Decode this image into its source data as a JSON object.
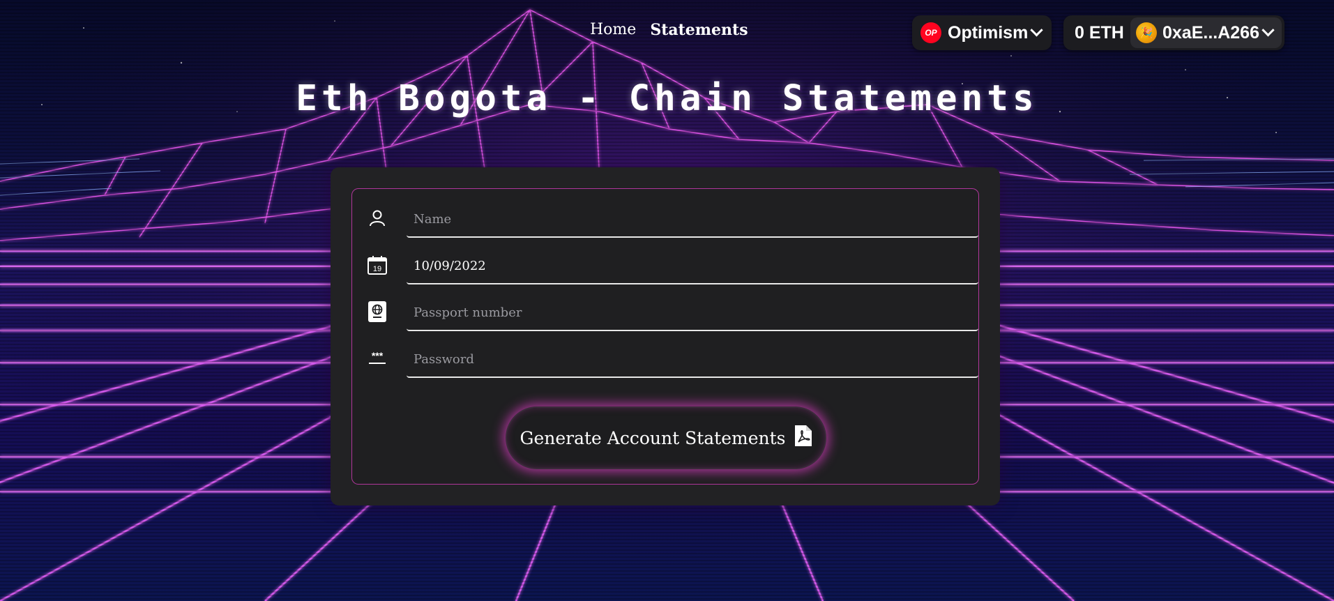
{
  "nav": {
    "home": "Home",
    "statements": "Statements"
  },
  "wallet": {
    "chain_logo": "OP",
    "chain_name": "Optimism",
    "balance": "0 ETH",
    "avatar_emoji": "🎉",
    "address": "0xaE...A266"
  },
  "title": "Eth Bogota - Chain Statements",
  "form": {
    "name_placeholder": "Name",
    "date_value": "10/09/2022",
    "calendar_day": "19",
    "passport_placeholder": "Passport number",
    "password_placeholder": "Password",
    "password_icon_text": "***",
    "submit_label": "Generate Account Statements"
  },
  "icons": {
    "name": "user-icon",
    "date": "calendar-icon",
    "passport": "passport-icon",
    "password": "password-icon",
    "submit": "pdf-file-icon"
  },
  "colors": {
    "accent": "#d63cbe",
    "op_red": "#ff0420",
    "card": "#222224"
  }
}
